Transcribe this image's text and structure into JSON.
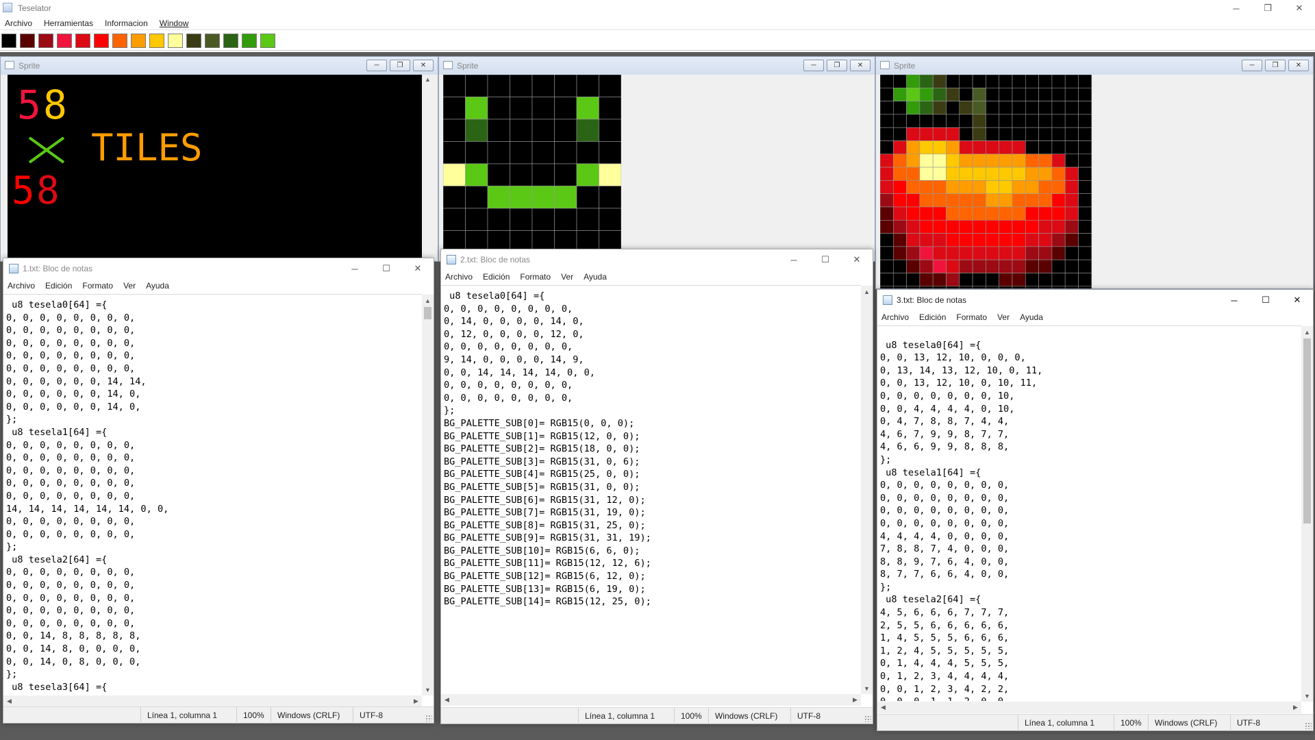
{
  "app": {
    "title": "Teselator",
    "menu": [
      "Archivo",
      "Herramientas",
      "Informacion",
      "Window"
    ],
    "palette_colors": [
      "#000000",
      "#5a0000",
      "#9c0a14",
      "#f0143c",
      "#dc0a14",
      "#ff0000",
      "#ff6400",
      "#ff9c00",
      "#ffc800",
      "#ffff9c",
      "#3c3c14",
      "#4a5a24",
      "#2a6414",
      "#329c0a",
      "#5ac814"
    ]
  },
  "sprites": {
    "title": "Sprite",
    "win1_text": {
      "top_left": "5",
      "top_right": "8",
      "middle": "TILES",
      "bottom": "5",
      "bottom2": "8"
    },
    "win2_grid": [
      [
        0,
        0,
        0,
        0,
        0,
        0,
        0,
        0
      ],
      [
        0,
        14,
        0,
        0,
        0,
        0,
        14,
        0
      ],
      [
        0,
        12,
        0,
        0,
        0,
        0,
        12,
        0
      ],
      [
        0,
        0,
        0,
        0,
        0,
        0,
        0,
        0
      ],
      [
        9,
        14,
        0,
        0,
        0,
        0,
        14,
        9
      ],
      [
        0,
        0,
        14,
        14,
        14,
        14,
        0,
        0
      ],
      [
        0,
        0,
        0,
        0,
        0,
        0,
        0,
        0
      ],
      [
        0,
        0,
        0,
        0,
        0,
        0,
        0,
        0
      ]
    ],
    "win3_grid": [
      [
        0,
        0,
        13,
        12,
        10,
        0,
        0,
        0,
        0,
        0,
        0,
        0,
        0,
        0,
        0,
        0
      ],
      [
        0,
        13,
        14,
        13,
        12,
        10,
        0,
        11,
        0,
        0,
        0,
        0,
        0,
        0,
        0,
        0
      ],
      [
        0,
        0,
        13,
        12,
        10,
        0,
        10,
        11,
        0,
        0,
        0,
        0,
        0,
        0,
        0,
        0
      ],
      [
        0,
        0,
        0,
        0,
        0,
        0,
        0,
        10,
        0,
        0,
        0,
        0,
        0,
        0,
        0,
        0
      ],
      [
        0,
        0,
        4,
        4,
        4,
        4,
        0,
        10,
        0,
        0,
        0,
        0,
        0,
        0,
        0,
        0
      ],
      [
        0,
        4,
        7,
        8,
        8,
        7,
        4,
        4,
        4,
        4,
        4,
        0,
        0,
        0,
        0,
        0
      ],
      [
        4,
        6,
        7,
        9,
        9,
        8,
        7,
        7,
        7,
        7,
        7,
        6,
        6,
        4,
        0,
        0
      ],
      [
        4,
        6,
        6,
        9,
        9,
        8,
        8,
        8,
        8,
        8,
        8,
        7,
        7,
        6,
        4,
        0
      ],
      [
        4,
        5,
        6,
        6,
        6,
        7,
        7,
        7,
        8,
        8,
        7,
        7,
        6,
        6,
        4,
        0
      ],
      [
        2,
        5,
        5,
        6,
        6,
        6,
        6,
        6,
        7,
        7,
        6,
        6,
        6,
        5,
        4,
        0
      ],
      [
        1,
        4,
        5,
        5,
        5,
        6,
        6,
        6,
        6,
        6,
        6,
        5,
        5,
        5,
        4,
        0
      ],
      [
        1,
        2,
        4,
        5,
        5,
        5,
        5,
        5,
        5,
        5,
        5,
        5,
        4,
        4,
        2,
        0
      ],
      [
        0,
        1,
        4,
        4,
        4,
        5,
        5,
        5,
        5,
        5,
        5,
        4,
        4,
        2,
        1,
        0
      ],
      [
        0,
        1,
        2,
        3,
        4,
        4,
        4,
        4,
        4,
        4,
        4,
        2,
        2,
        1,
        0,
        0
      ],
      [
        0,
        0,
        1,
        2,
        3,
        4,
        2,
        2,
        2,
        2,
        2,
        1,
        1,
        0,
        0,
        0
      ],
      [
        0,
        0,
        0,
        1,
        1,
        2,
        0,
        0,
        0,
        1,
        1,
        0,
        0,
        0,
        0,
        0
      ]
    ]
  },
  "notepad1": {
    "title": "1.txt: Bloc de notas",
    "menu": [
      "Archivo",
      "Edición",
      "Formato",
      "Ver",
      "Ayuda"
    ],
    "content": " u8 tesela0[64] ={\n0, 0, 0, 0, 0, 0, 0, 0,\n0, 0, 0, 0, 0, 0, 0, 0,\n0, 0, 0, 0, 0, 0, 0, 0,\n0, 0, 0, 0, 0, 0, 0, 0,\n0, 0, 0, 0, 0, 0, 0, 0,\n0, 0, 0, 0, 0, 0, 14, 14,\n0, 0, 0, 0, 0, 0, 14, 0,\n0, 0, 0, 0, 0, 0, 14, 0,\n};\n u8 tesela1[64] ={\n0, 0, 0, 0, 0, 0, 0, 0,\n0, 0, 0, 0, 0, 0, 0, 0,\n0, 0, 0, 0, 0, 0, 0, 0,\n0, 0, 0, 0, 0, 0, 0, 0,\n0, 0, 0, 0, 0, 0, 0, 0,\n14, 14, 14, 14, 14, 14, 0, 0,\n0, 0, 0, 0, 0, 0, 0, 0,\n0, 0, 0, 0, 0, 0, 0, 0,\n};\n u8 tesela2[64] ={\n0, 0, 0, 0, 0, 0, 0, 0,\n0, 0, 0, 0, 0, 0, 0, 0,\n0, 0, 0, 0, 0, 0, 0, 0,\n0, 0, 0, 0, 0, 0, 0, 0,\n0, 0, 0, 0, 0, 0, 0, 0,\n0, 0, 14, 8, 8, 8, 8, 8,\n0, 0, 14, 8, 0, 0, 0, 0,\n0, 0, 14, 0, 8, 0, 0, 0,\n};\n u8 tesela3[64] ={",
    "status": {
      "position": "Línea 1, columna 1",
      "zoom": "100%",
      "eol": "Windows (CRLF)",
      "encoding": "UTF-8"
    }
  },
  "notepad2": {
    "title": "2.txt: Bloc de notas",
    "menu": [
      "Archivo",
      "Edición",
      "Formato",
      "Ver",
      "Ayuda"
    ],
    "content": " u8 tesela0[64] ={\n0, 0, 0, 0, 0, 0, 0, 0,\n0, 14, 0, 0, 0, 0, 14, 0,\n0, 12, 0, 0, 0, 0, 12, 0,\n0, 0, 0, 0, 0, 0, 0, 0,\n9, 14, 0, 0, 0, 0, 14, 9,\n0, 0, 14, 14, 14, 14, 0, 0,\n0, 0, 0, 0, 0, 0, 0, 0,\n0, 0, 0, 0, 0, 0, 0, 0,\n};\nBG_PALETTE_SUB[0]= RGB15(0, 0, 0);\nBG_PALETTE_SUB[1]= RGB15(12, 0, 0);\nBG_PALETTE_SUB[2]= RGB15(18, 0, 0);\nBG_PALETTE_SUB[3]= RGB15(31, 0, 6);\nBG_PALETTE_SUB[4]= RGB15(25, 0, 0);\nBG_PALETTE_SUB[5]= RGB15(31, 0, 0);\nBG_PALETTE_SUB[6]= RGB15(31, 12, 0);\nBG_PALETTE_SUB[7]= RGB15(31, 19, 0);\nBG_PALETTE_SUB[8]= RGB15(31, 25, 0);\nBG_PALETTE_SUB[9]= RGB15(31, 31, 19);\nBG_PALETTE_SUB[10]= RGB15(6, 6, 0);\nBG_PALETTE_SUB[11]= RGB15(12, 12, 6);\nBG_PALETTE_SUB[12]= RGB15(6, 12, 0);\nBG_PALETTE_SUB[13]= RGB15(6, 19, 0);\nBG_PALETTE_SUB[14]= RGB15(12, 25, 0);",
    "status": {
      "position": "Línea 1, columna 1",
      "zoom": "100%",
      "eol": "Windows (CRLF)",
      "encoding": "UTF-8"
    }
  },
  "notepad3": {
    "title": "3.txt: Bloc de notas",
    "menu": [
      "Archivo",
      "Edición",
      "Formato",
      "Ver",
      "Ayuda"
    ],
    "content": "\n u8 tesela0[64] ={\n0, 0, 13, 12, 10, 0, 0, 0,\n0, 13, 14, 13, 12, 10, 0, 11,\n0, 0, 13, 12, 10, 0, 10, 11,\n0, 0, 0, 0, 0, 0, 0, 10,\n0, 0, 4, 4, 4, 4, 0, 10,\n0, 4, 7, 8, 8, 7, 4, 4,\n4, 6, 7, 9, 9, 8, 7, 7,\n4, 6, 6, 9, 9, 8, 8, 8,\n};\n u8 tesela1[64] ={\n0, 0, 0, 0, 0, 0, 0, 0,\n0, 0, 0, 0, 0, 0, 0, 0,\n0, 0, 0, 0, 0, 0, 0, 0,\n0, 0, 0, 0, 0, 0, 0, 0,\n4, 4, 4, 4, 0, 0, 0, 0,\n7, 8, 8, 7, 4, 0, 0, 0,\n8, 8, 9, 7, 6, 4, 0, 0,\n8, 7, 7, 6, 6, 4, 0, 0,\n};\n u8 tesela2[64] ={\n4, 5, 6, 6, 6, 7, 7, 7,\n2, 5, 5, 6, 6, 6, 6, 6,\n1, 4, 5, 5, 5, 6, 6, 6,\n1, 2, 4, 5, 5, 5, 5, 5,\n0, 1, 4, 4, 4, 5, 5, 5,\n0, 1, 2, 3, 4, 4, 4, 4,\n0, 0, 1, 2, 3, 4, 2, 2,\n0, 0, 0, 1, 1, 2, 0, 0,",
    "status": {
      "position": "Línea 1, columna 1",
      "zoom": "100%",
      "eol": "Windows (CRLF)",
      "encoding": "UTF-8"
    }
  },
  "icons": {
    "minimize": "─",
    "maximize": "☐",
    "close": "✕",
    "restore": "❐",
    "up": "▲",
    "down": "▼",
    "left": "◀",
    "right": "▶"
  }
}
